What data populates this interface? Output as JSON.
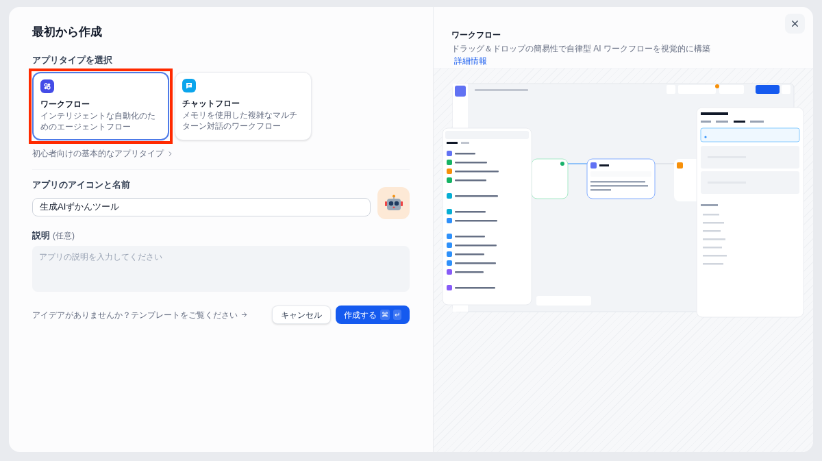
{
  "dialog": {
    "title": "最初から作成"
  },
  "app_type": {
    "label": "アプリタイプを選択",
    "beginner_link": "初心者向けの基本的なアプリタイプ",
    "options": [
      {
        "kind": "workflow",
        "title": "ワークフロー",
        "description": "インテリジェントな自動化のためのエージェントフロー",
        "selected": true
      },
      {
        "kind": "chatflow",
        "title": "チャットフロー",
        "description": "メモリを使用した複雑なマルチターン対話のワークフロー",
        "selected": false
      }
    ]
  },
  "name_field": {
    "label": "アプリのアイコンと名前",
    "value": "生成AIずかんツール"
  },
  "description_field": {
    "label": "説明",
    "optional": "(任意)",
    "placeholder": "アプリの説明を入力してください"
  },
  "template_link": "アイデアがありませんか？テンプレートをご覧ください",
  "buttons": [
    {
      "kind": "cancel",
      "label": "キャンセル"
    },
    {
      "kind": "create",
      "label": "作成する",
      "shortcut": [
        "⌘",
        "↵"
      ]
    }
  ],
  "preview": {
    "title": "ワークフロー",
    "description": "ドラッグ＆ドロップの簡易性で自律型 AI ワークフローを視覚的に構築",
    "link": "詳細情報"
  }
}
